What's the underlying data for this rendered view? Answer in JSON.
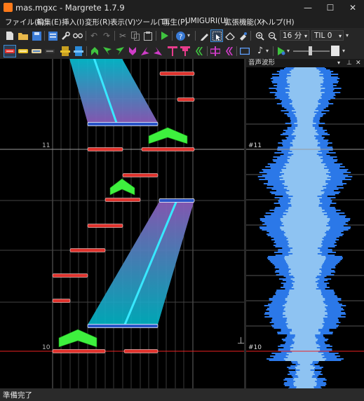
{
  "window": {
    "title": "mas.mgxc - Margrete 1.7.9",
    "minimize": "—",
    "maximize": "☐",
    "close": "✕"
  },
  "menu": [
    "ファイル(F)",
    "編集(E)",
    "挿入(I)",
    "変形(R)",
    "表示(V)",
    "ツール(T)",
    "再生(P)",
    "UMIGURI(U)",
    "拡張機能(X)",
    "ヘルプ(H)"
  ],
  "toolbar": {
    "division": "16 分",
    "til": "TIL 0"
  },
  "editor": {
    "measure_labels": [
      "11",
      "10"
    ],
    "end_marker": "⊥"
  },
  "wave_panel": {
    "title": "音声波形",
    "measure_labels": [
      "#11",
      "#10"
    ]
  },
  "status": "準備完了"
}
